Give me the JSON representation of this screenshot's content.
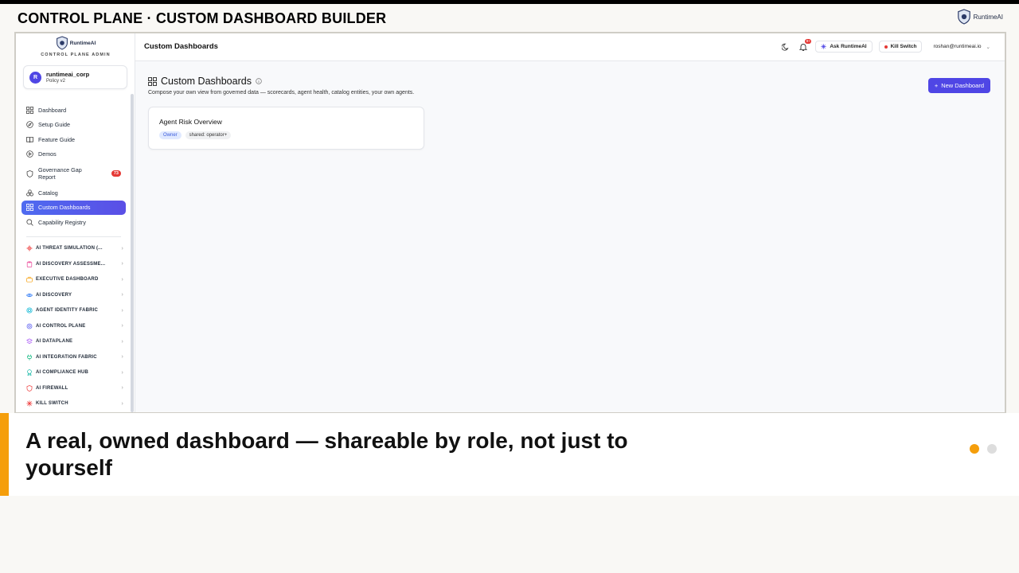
{
  "slide": {
    "title": "CONTROL PLANE · CUSTOM DASHBOARD BUILDER",
    "brand": "RuntimeAI",
    "caption": "A real, owned dashboard — shareable by role, not just to yourself",
    "pager": {
      "total": 2,
      "current": 1
    },
    "accent_color": "#f59e0b"
  },
  "sidebar": {
    "brand": "RuntimeAI",
    "subtitle": "CONTROL PLANE ADMIN",
    "tenant": {
      "initial": "R",
      "name": "runtimeai_corp",
      "policy": "Policy v2"
    },
    "items": [
      {
        "label": "Dashboard",
        "icon": "grid-icon"
      },
      {
        "label": "Setup Guide",
        "icon": "compass-icon"
      },
      {
        "label": "Feature Guide",
        "icon": "book-icon"
      },
      {
        "label": "Demos",
        "icon": "play-circle-icon"
      },
      {
        "label": "Governance Gap Report",
        "icon": "shield-icon",
        "badge": "73"
      },
      {
        "label": "Catalog",
        "icon": "boxes-icon"
      },
      {
        "label": "Custom Dashboards",
        "icon": "grid-icon",
        "active": true
      },
      {
        "label": "Capability Registry",
        "icon": "search-icon"
      }
    ],
    "sections": [
      {
        "label": "AI THREAT SIMULATION (...",
        "color": "#ef4444"
      },
      {
        "label": "AI DISCOVERY ASSESSME...",
        "color": "#ec4899"
      },
      {
        "label": "EXECUTIVE DASHBOARD",
        "color": "#f59e0b"
      },
      {
        "label": "AI DISCOVERY",
        "color": "#3b82f6"
      },
      {
        "label": "AGENT IDENTITY FABRIC",
        "color": "#06b6d4"
      },
      {
        "label": "AI CONTROL PLANE",
        "color": "#6366f1"
      },
      {
        "label": "AI DATAPLANE",
        "color": "#a855f7"
      },
      {
        "label": "AI INTEGRATION FABRIC",
        "color": "#10b981"
      },
      {
        "label": "AI COMPLIANCE HUB",
        "color": "#14b8a6"
      },
      {
        "label": "AI FIREWALL",
        "color": "#ef4444"
      },
      {
        "label": "KILL SWITCH",
        "color": "#ef4444"
      }
    ]
  },
  "header": {
    "title": "Custom Dashboards",
    "notifications_badge": "9+",
    "ask_label": "Ask RuntimeAI",
    "kill_label": "Kill Switch",
    "user": "roshan@runtimeai.io"
  },
  "content": {
    "title": "Custom Dashboards",
    "subtitle": "Compose your own view from governed data — scorecards, agent health, catalog entities, your own agents.",
    "new_button": "New Dashboard",
    "cards": [
      {
        "title": "Agent Risk Overview",
        "tags": [
          "Owner",
          "shared: operator+"
        ]
      }
    ]
  }
}
